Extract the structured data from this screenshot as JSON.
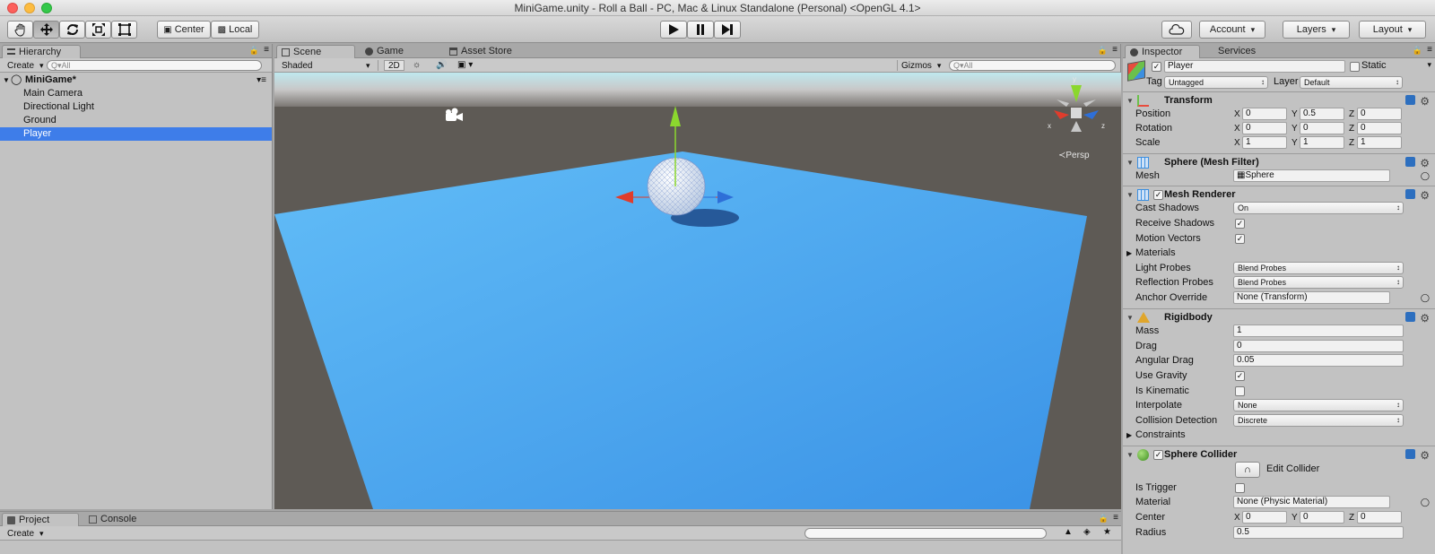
{
  "window": {
    "title": "MiniGame.unity - Roll a Ball - PC, Mac & Linux Standalone (Personal) <OpenGL 4.1>"
  },
  "toolbar": {
    "tools": [
      {
        "name": "hand-tool",
        "icon": "hand-icon"
      },
      {
        "name": "move-tool",
        "icon": "move-icon"
      },
      {
        "name": "rotate-tool",
        "icon": "rotate-icon"
      },
      {
        "name": "scale-tool",
        "icon": "scale-icon"
      },
      {
        "name": "rect-tool",
        "icon": "rect-icon"
      }
    ],
    "pivot_label": "Center",
    "space_label": "Local",
    "play_icon": "play-icon",
    "pause_icon": "pause-icon",
    "step_icon": "step-icon",
    "cloud_icon": "cloud-icon",
    "account_label": "Account",
    "layers_label": "Layers",
    "layout_label": "Layout"
  },
  "hierarchy": {
    "tab_label": "Hierarchy",
    "create_label": "Create",
    "search_placeholder": "Q▾All",
    "scene_name": "MiniGame*",
    "items": [
      "Main Camera",
      "Directional Light",
      "Ground",
      "Player"
    ],
    "selected_index": 3
  },
  "scene": {
    "tabs": [
      "Scene",
      "Game",
      "Asset Store"
    ],
    "shading_mode": "Shaded",
    "mode_2d_label": "2D",
    "gizmos_label": "Gizmos",
    "search_placeholder": "Q▾All",
    "gizmo_labels": {
      "x": "x",
      "y": "y",
      "z": "z"
    },
    "persp_label": "≺Persp",
    "colors": {
      "sky": "#bfe7f0",
      "ground": "#5e5a55",
      "plane": "#4aa8f0",
      "x_axis": "#e03c2c",
      "y_axis": "#8bd72e",
      "z_axis": "#2e6fd8"
    }
  },
  "inspector": {
    "tabs": [
      "Inspector",
      "Services"
    ],
    "object_name": "Player",
    "static_label": "Static",
    "tag_label": "Tag",
    "tag_value": "Untagged",
    "layer_label": "Layer",
    "layer_value": "Default",
    "transform": {
      "title": "Transform",
      "position_label": "Position",
      "rotation_label": "Rotation",
      "scale_label": "Scale",
      "position": [
        "0",
        "0.5",
        "0"
      ],
      "rotation": [
        "0",
        "0",
        "0"
      ],
      "scale": [
        "1",
        "1",
        "1"
      ],
      "axis_labels": [
        "X",
        "Y",
        "Z"
      ]
    },
    "mesh_filter": {
      "title": "Sphere (Mesh Filter)",
      "mesh_label": "Mesh",
      "mesh_value": "Sphere"
    },
    "mesh_renderer": {
      "title": "Mesh Renderer",
      "cast_shadows_label": "Cast Shadows",
      "cast_shadows_value": "On",
      "receive_shadows_label": "Receive Shadows",
      "motion_vectors_label": "Motion Vectors",
      "materials_label": "Materials",
      "light_probes_label": "Light Probes",
      "light_probes_value": "Blend Probes",
      "reflection_probes_label": "Reflection Probes",
      "reflection_probes_value": "Blend Probes",
      "anchor_override_label": "Anchor Override",
      "anchor_override_value": "None (Transform)"
    },
    "rigidbody": {
      "title": "Rigidbody",
      "mass_label": "Mass",
      "mass_value": "1",
      "drag_label": "Drag",
      "drag_value": "0",
      "angular_drag_label": "Angular Drag",
      "angular_drag_value": "0.05",
      "use_gravity_label": "Use Gravity",
      "is_kinematic_label": "Is Kinematic",
      "interpolate_label": "Interpolate",
      "interpolate_value": "None",
      "collision_detection_label": "Collision Detection",
      "collision_detection_value": "Discrete",
      "constraints_label": "Constraints"
    },
    "sphere_collider": {
      "title": "Sphere Collider",
      "edit_collider_label": "Edit Collider",
      "is_trigger_label": "Is Trigger",
      "material_label": "Material",
      "material_value": "None (Physic Material)",
      "center_label": "Center",
      "center": [
        "0",
        "0",
        "0"
      ],
      "radius_label": "Radius",
      "radius_value": "0.5"
    }
  },
  "bottom": {
    "tabs": [
      "Project",
      "Console"
    ],
    "create_label": "Create"
  }
}
